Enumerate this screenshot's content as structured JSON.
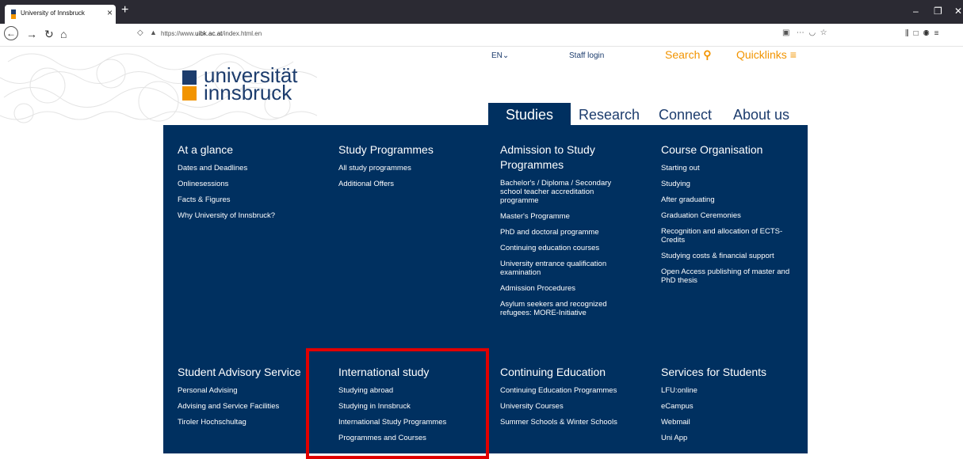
{
  "browser": {
    "tab_title": "University of Innsbruck",
    "url_prefix": "https://www.",
    "url_domain": "uibk.ac.at",
    "url_path": "/index.html.en"
  },
  "header": {
    "logo_line1": "universität",
    "logo_line2": "innsbruck",
    "lang": "EN",
    "staff_login": "Staff login",
    "search": "Search",
    "quicklinks": "Quicklinks"
  },
  "mainnav": [
    "Studies",
    "Research",
    "Connect",
    "About us"
  ],
  "sections": [
    {
      "title": "At a glance",
      "links": [
        "Dates and Deadlines",
        "Onlinesessions",
        "Facts & Figures",
        "Why University of Innsbruck?"
      ]
    },
    {
      "title": "Study Programmes",
      "links": [
        "All study programmes",
        "Additional Offers"
      ]
    },
    {
      "title": "Admission to Study Programmes",
      "links": [
        "Bachelor's / Diploma / Secondary school teacher accreditation programme",
        "Master's Programme",
        "PhD and doctoral programme",
        "Continuing education courses",
        "University entrance qualification examination",
        "Admission Procedures",
        "Asylum seekers and recognized refugees: MORE-Initiative"
      ]
    },
    {
      "title": "Course Organisation",
      "links": [
        "Starting out",
        "Studying",
        "After graduating",
        "Graduation Ceremonies",
        "Recognition and allocation of ECTS-Credits",
        "Studying costs & financial support",
        "Open Access publishing of master and PhD thesis"
      ]
    },
    {
      "title": "Student Advisory Service",
      "links": [
        "Personal Advising",
        "Advising and Service Facilities",
        "Tiroler Hochschultag"
      ]
    },
    {
      "title": "International study",
      "links": [
        "Studying abroad",
        "Studying in Innsbruck",
        "International Study Programmes",
        "Programmes and Courses"
      ]
    },
    {
      "title": "Continuing Education",
      "links": [
        "Continuing Education Programmes",
        "University Courses",
        "Summer Schools & Winter Schools"
      ]
    },
    {
      "title": "Services for Students",
      "links": [
        "LFU:online",
        "eCampus",
        "Webmail",
        "Uni App"
      ]
    }
  ]
}
